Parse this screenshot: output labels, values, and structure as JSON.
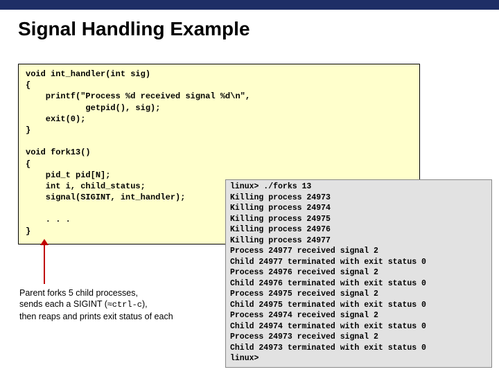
{
  "title": "Signal Handling Example",
  "code": "void int_handler(int sig)\n{\n    printf(\"Process %d received signal %d\\n\",\n            getpid(), sig);\n    exit(0);\n}\n\nvoid fork13()\n{\n    pid_t pid[N];\n    int i, child_status;\n    signal(SIGINT, int_handler);\n\n    . . .\n}",
  "note_line1": "Parent forks 5 child processes,",
  "note_line2_a": "sends each a SIGINT (≈",
  "note_line2_mono": "ctrl-c",
  "note_line2_b": "),",
  "note_line3": "then reaps and prints exit status of each",
  "output": "linux> ./forks 13\nKilling process 24973\nKilling process 24974\nKilling process 24975\nKilling process 24976\nKilling process 24977\nProcess 24977 received signal 2\nChild 24977 terminated with exit status 0\nProcess 24976 received signal 2\nChild 24976 terminated with exit status 0\nProcess 24975 received signal 2\nChild 24975 terminated with exit status 0\nProcess 24974 received signal 2\nChild 24974 terminated with exit status 0\nProcess 24973 received signal 2\nChild 24973 terminated with exit status 0\nlinux>"
}
